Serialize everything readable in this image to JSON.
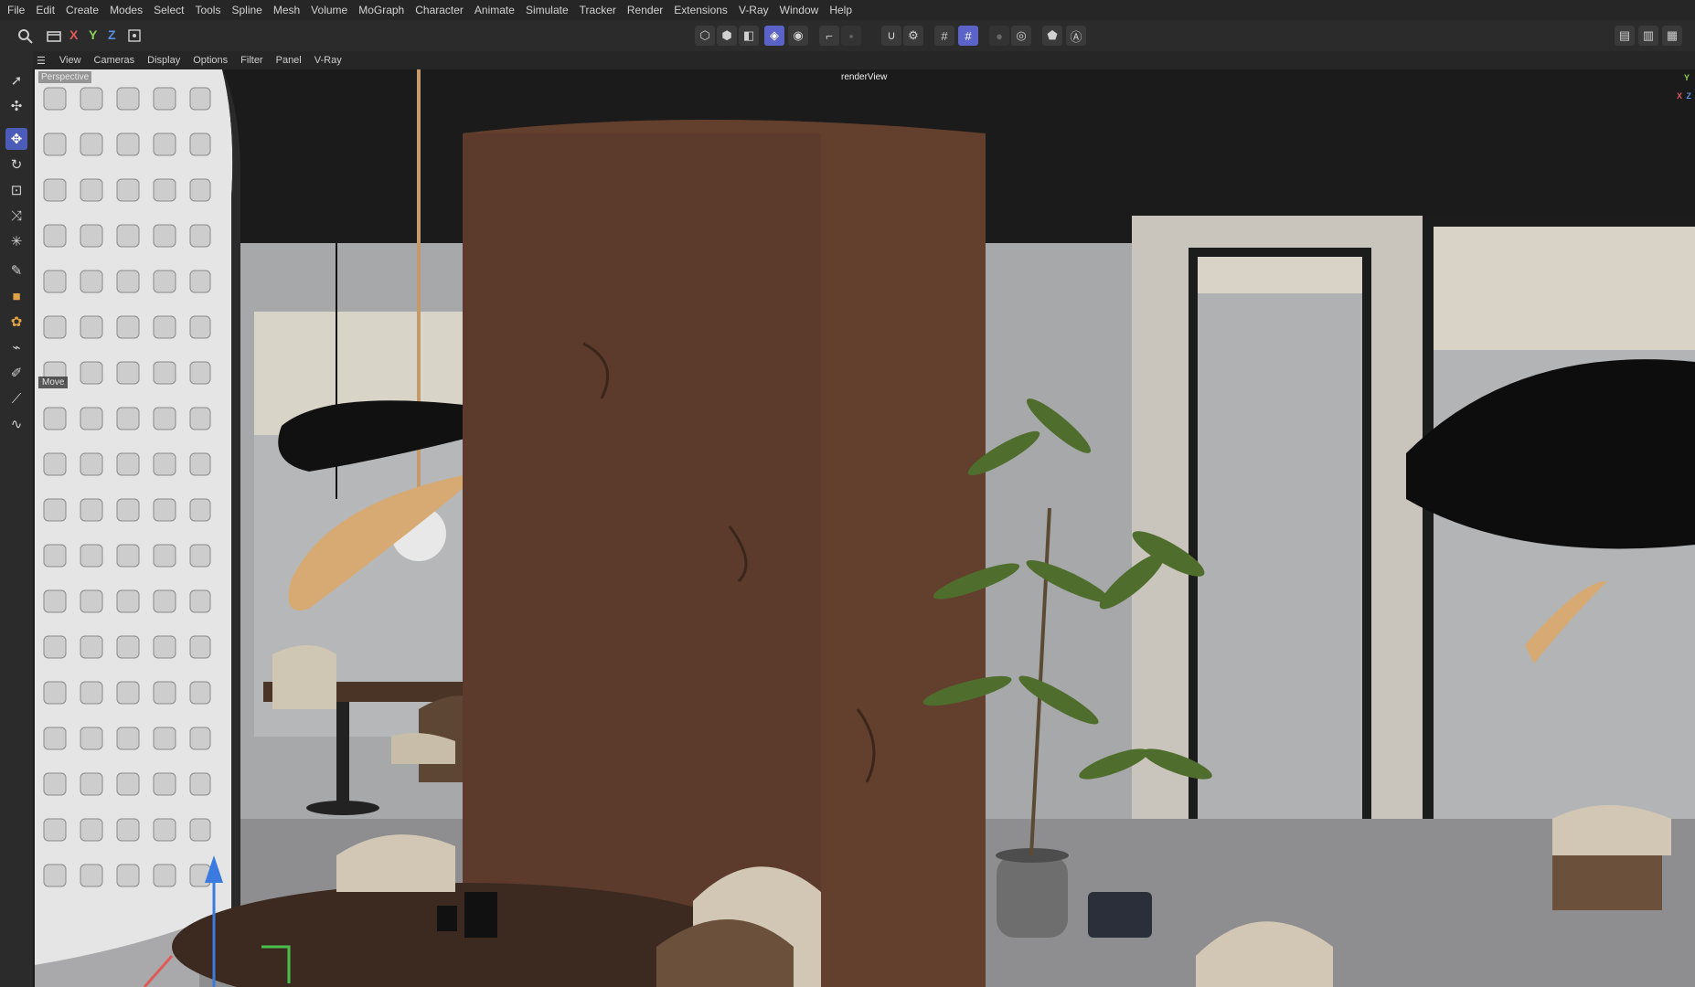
{
  "menu": [
    "File",
    "Edit",
    "Create",
    "Modes",
    "Select",
    "Tools",
    "Spline",
    "Mesh",
    "Volume",
    "MoGraph",
    "Character",
    "Animate",
    "Simulate",
    "Tracker",
    "Render",
    "Extensions",
    "V-Ray",
    "Window",
    "Help"
  ],
  "toolbar": {
    "axis_x": "X",
    "axis_y": "Y",
    "axis_z": "Z",
    "colors": {
      "x": "#e05a5a",
      "y": "#8fcf5a",
      "z": "#5a8fe0",
      "accent": "#5b63c9"
    }
  },
  "viewport_menu": [
    "View",
    "Cameras",
    "Display",
    "Options",
    "Filter",
    "Panel",
    "V-Ray"
  ],
  "viewport": {
    "camera_label": "Perspective",
    "render_label": "renderView",
    "tool_tip": "Move",
    "gizmo_x": "X",
    "gizmo_y": "Y",
    "gizmo_z": "Z"
  }
}
